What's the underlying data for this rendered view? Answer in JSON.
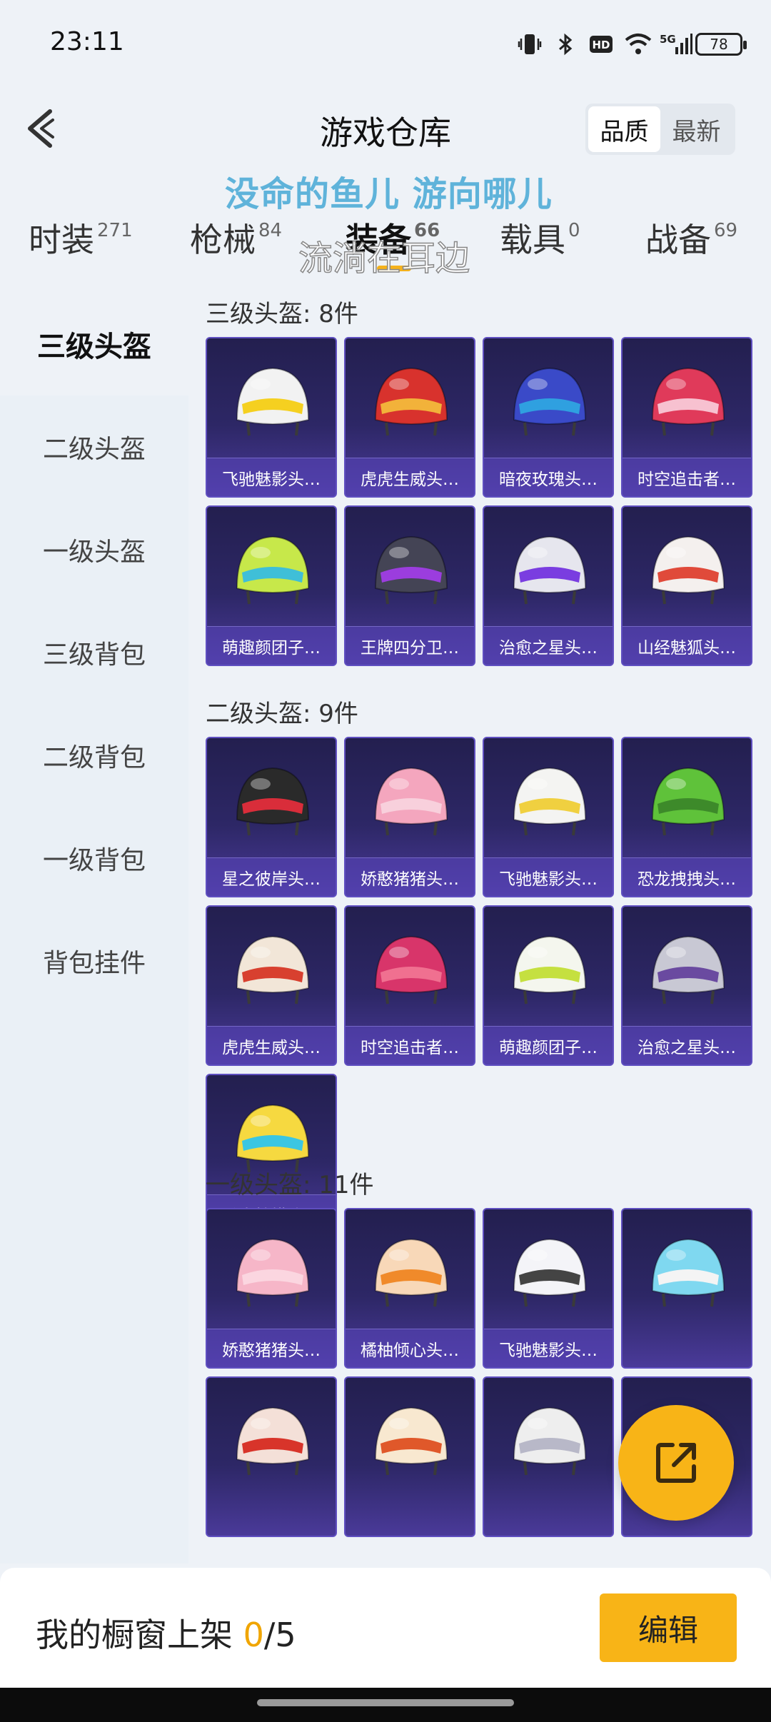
{
  "status": {
    "time": "23:11",
    "battery": "78",
    "network": "5G",
    "hd": "HD"
  },
  "header": {
    "title": "游戏仓库",
    "sort_options": [
      "品质",
      "最新"
    ],
    "sort_active": 0
  },
  "overlay_text": [
    "没命的鱼儿 游向哪儿",
    "流淌在耳边"
  ],
  "tabs": [
    {
      "label": "时装",
      "count": "271"
    },
    {
      "label": "枪械",
      "count": "84"
    },
    {
      "label": "装备",
      "count": "66"
    },
    {
      "label": "载具",
      "count": "0"
    },
    {
      "label": "战备",
      "count": "69"
    }
  ],
  "active_tab": 2,
  "sidebar": {
    "items": [
      "三级头盔",
      "二级头盔",
      "一级头盔",
      "三级背包",
      "二级背包",
      "一级背包",
      "背包挂件"
    ],
    "active": 0
  },
  "sections": [
    {
      "title": "三级头盔: 8件",
      "items": [
        "飞驰魅影头…",
        "虎虎生威头…",
        "暗夜玫瑰头…",
        "时空追击者…",
        "萌趣颜团子…",
        "王牌四分卫…",
        "治愈之星头…",
        "山经魅狐头…"
      ]
    },
    {
      "title": "二级头盔: 9件",
      "items": [
        "星之彼岸头…",
        "娇憨猪猪头…",
        "飞驰魅影头…",
        "恐龙拽拽头…",
        "虎虎生威头…",
        "时空追击者…",
        "萌趣颜团子…",
        "治愈之星头…",
        "香水柠檬头…"
      ]
    },
    {
      "title": "一级头盔: 11件",
      "items": [
        "娇憨猪猪头…",
        "橘柚倾心头…",
        "飞驰魅影头…",
        "",
        "",
        "",
        "",
        ""
      ]
    }
  ],
  "item_colors": [
    [
      "#f2f2f2",
      "#f5d020"
    ],
    [
      "#d8322d",
      "#f2b23a"
    ],
    [
      "#3a4ac8",
      "#2fa0e0"
    ],
    [
      "#e03a5a",
      "#f7c1d0"
    ],
    [
      "#c7e84a",
      "#3fbfd8"
    ],
    [
      "#444455",
      "#9b3dde"
    ],
    [
      "#e6e6ee",
      "#7a3de0"
    ],
    [
      "#f4f0ee",
      "#e04a3a"
    ],
    [
      "#2a2a2a",
      "#d92d3a"
    ],
    [
      "#f4a6be",
      "#f8d0dc"
    ],
    [
      "#f4f4f2",
      "#f0d040"
    ],
    [
      "#5fc23a",
      "#3d8a2a"
    ],
    [
      "#f2e6d8",
      "#d8402f"
    ],
    [
      "#d8356a",
      "#f07090"
    ],
    [
      "#f4f6ee",
      "#c5e040"
    ],
    [
      "#c8c8d4",
      "#6a4aa0"
    ],
    [
      "#f6d940",
      "#3bc6e2"
    ],
    [
      "#f6b6c8",
      "#fbd6e0"
    ],
    [
      "#f8d8b8",
      "#f08a2a"
    ],
    [
      "#f4f4f8",
      "#444444"
    ],
    [
      "#7fd8f0",
      "#f4f4f4"
    ],
    [
      "#f4e0d8",
      "#d8342a"
    ],
    [
      "#f8e8d0",
      "#e0582a"
    ],
    [
      "#eeeeee",
      "#b8b8c8"
    ],
    [
      "#e03060",
      "#f8b0c0"
    ]
  ],
  "bottom": {
    "showcase_label": "我的橱窗上架 ",
    "showcase_count": "0",
    "showcase_total": "/5",
    "edit_label": "编辑"
  }
}
